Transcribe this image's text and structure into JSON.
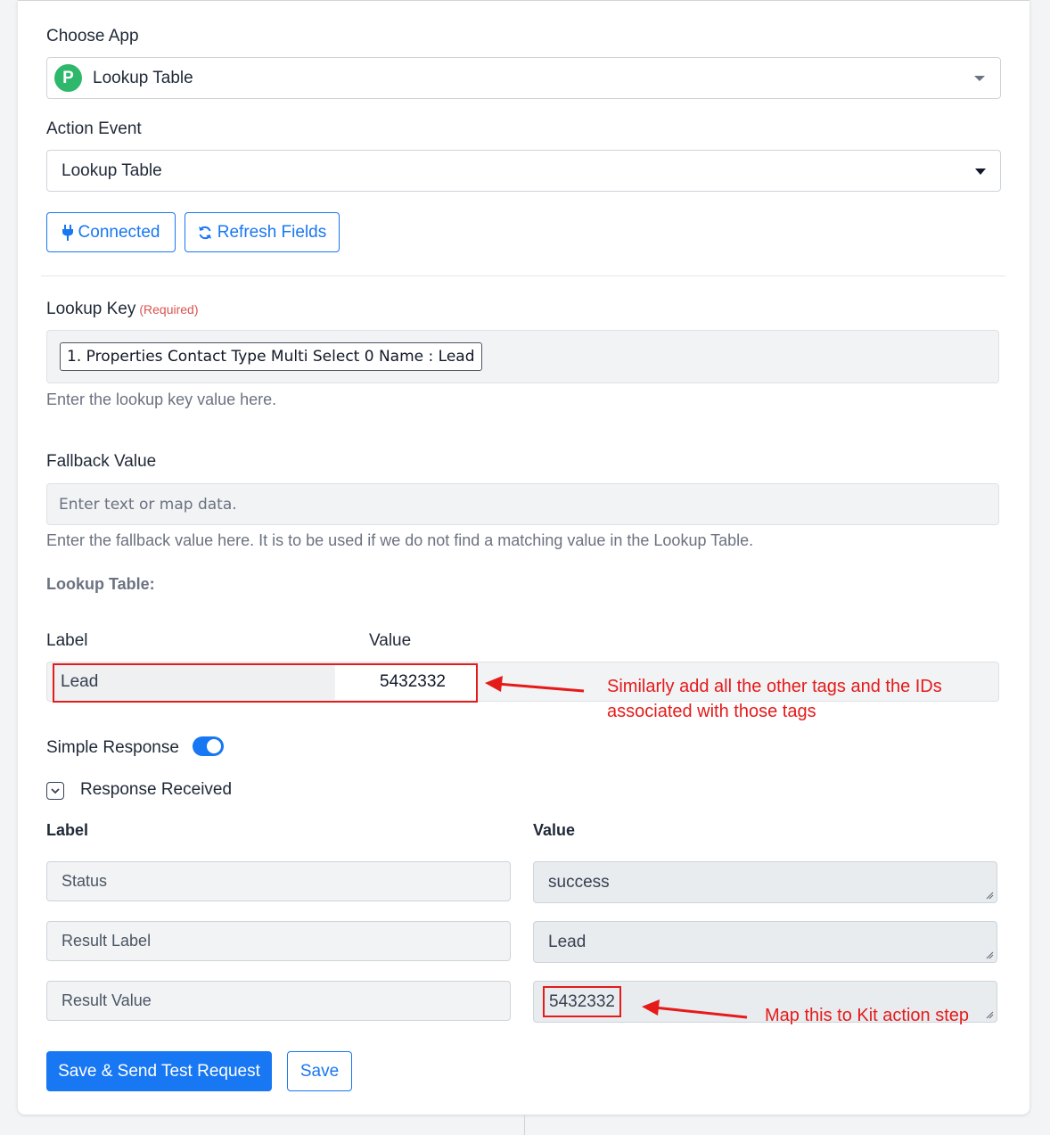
{
  "choose_app": {
    "label": "Choose App",
    "value": "Lookup Table",
    "logo_letter": "P"
  },
  "action_event": {
    "label": "Action Event",
    "value": "Lookup Table"
  },
  "buttons": {
    "connected": "Connected",
    "refresh": "Refresh Fields"
  },
  "lookup_key": {
    "label": "Lookup Key",
    "required": "(Required)",
    "token": "1. Properties Contact Type Multi Select 0 Name : Lead",
    "help": "Enter the lookup key value here."
  },
  "fallback": {
    "label": "Fallback Value",
    "placeholder": "Enter text or map data.",
    "help": "Enter the fallback value here. It is to be used if we do not find a matching value in the Lookup Table."
  },
  "lookup_table": {
    "title": "Lookup Table:",
    "col_label": "Label",
    "col_value": "Value",
    "row_label": "Lead",
    "row_value": "5432332"
  },
  "simple_response": {
    "label": "Simple Response",
    "enabled": true
  },
  "response_received": {
    "label": "Response Received",
    "col_label": "Label",
    "col_value": "Value",
    "rows": [
      {
        "label": "Status",
        "value": "success"
      },
      {
        "label": "Result Label",
        "value": "Lead"
      },
      {
        "label": "Result Value",
        "value": "5432332"
      }
    ]
  },
  "annotations": {
    "table_note_line1": "Similarly add all the other tags and the IDs",
    "table_note_line2": "associated with those tags",
    "result_note": "Map this to Kit action step"
  },
  "footer": {
    "save_send": "Save & Send Test Request",
    "save": "Save"
  },
  "colors": {
    "primary": "#1877f2",
    "annotation": "#e51b1b",
    "logo": "#2fb76c"
  }
}
